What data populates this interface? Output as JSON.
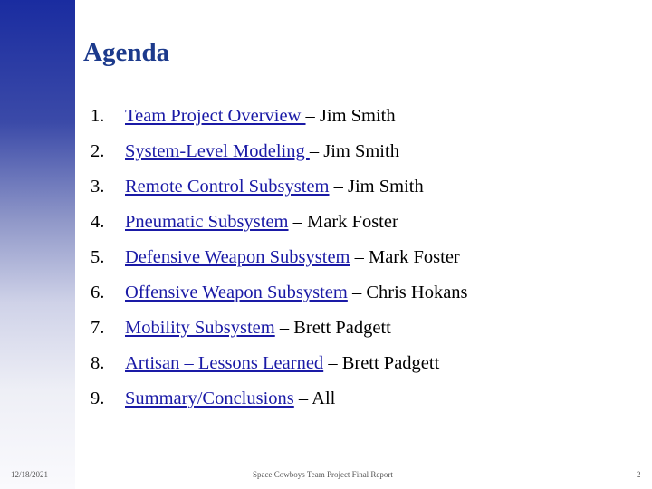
{
  "slide": {
    "title": "Agenda",
    "items": [
      {
        "number": "1.",
        "link": "Team Project Overview ",
        "presenter": " – Jim Smith"
      },
      {
        "number": "2.",
        "link": "System-Level Modeling ",
        "presenter": " – Jim Smith"
      },
      {
        "number": "3.",
        "link": "Remote Control Subsystem",
        "presenter": " – Jim Smith"
      },
      {
        "number": "4.",
        "link": "Pneumatic Subsystem",
        "presenter": " – Mark Foster"
      },
      {
        "number": "5.",
        "link": "Defensive Weapon Subsystem",
        "presenter": " – Mark Foster"
      },
      {
        "number": "6.",
        "link": "Offensive Weapon Subsystem",
        "presenter": " – Chris Hokans"
      },
      {
        "number": "7.",
        "link": "Mobility Subsystem",
        "presenter": " – Brett Padgett"
      },
      {
        "number": "8.",
        "link": "Artisan – Lessons Learned",
        "presenter": " – Brett Padgett"
      },
      {
        "number": "9.",
        "link": "Summary/Conclusions",
        "presenter": " – All"
      }
    ]
  },
  "footer": {
    "date": "12/18/2021",
    "center": "Space Cowboys Team Project Final Report",
    "page": "2"
  },
  "colors": {
    "title": "#1c3a8c",
    "link": "#1a1aa6",
    "sidebar_top": "#1a2ca0"
  }
}
